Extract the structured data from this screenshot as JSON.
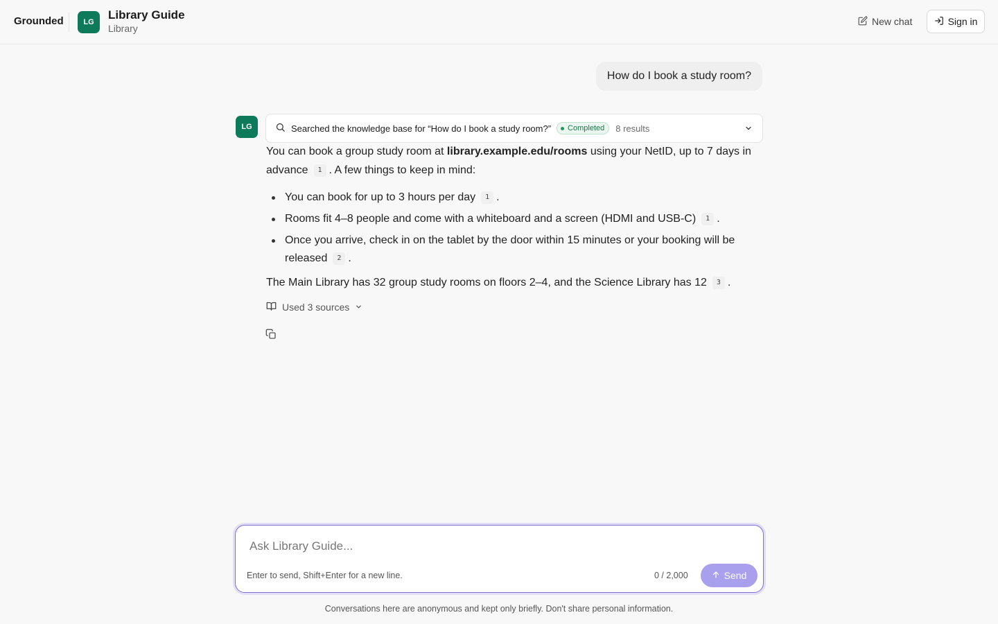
{
  "header": {
    "brand": "Grounded",
    "app_initials": "LG",
    "app_title": "Library Guide",
    "app_subtitle": "Library",
    "new_chat_label": "New chat",
    "sign_in_label": "Sign in"
  },
  "conversation": {
    "user_message": "How do I book a study room?",
    "assistant_initials": "LG",
    "search": {
      "text": "Searched the knowledge base for “How do I book a study room?”",
      "status": "Completed",
      "results": "8 results"
    },
    "answer": {
      "p1_a": "You can book a group study room at ",
      "p1_link": "library.example.edu/rooms",
      "p1_b": " using your NetID, up to 7 days in advance",
      "p1_cite": "1",
      "p1_c": ". A few things to keep in mind:",
      "bullets": [
        {
          "text": "You can book for up to 3 hours per day",
          "cite": "1",
          "end": "."
        },
        {
          "text": "Rooms fit 4–8 people and come with a whiteboard and a screen (HDMI and USB-C)",
          "cite": "1",
          "end": "."
        },
        {
          "text": "Once you arrive, check in on the tablet by the door within 15 minutes or your booking will be released",
          "cite": "2",
          "end": "."
        }
      ],
      "p2": "The Main Library has 32 group study rooms on floors 2–4, and the Science Library has 12",
      "p2_cite": "3",
      "p2_end": "."
    },
    "sources_label": "Used 3 sources"
  },
  "composer": {
    "placeholder": "Ask Library Guide...",
    "hint": "Enter to send, Shift+Enter for a new line.",
    "counter": "0 / 2,000",
    "send_label": "Send"
  },
  "footer_note": "Conversations here are anonymous and kept only briefly. Don't share personal information.",
  "colors": {
    "brand_green": "#0d7a5a",
    "accent_purple": "#7d6fe0",
    "send_disabled": "#a8a0ec",
    "status_green": "#1e9a5c"
  }
}
